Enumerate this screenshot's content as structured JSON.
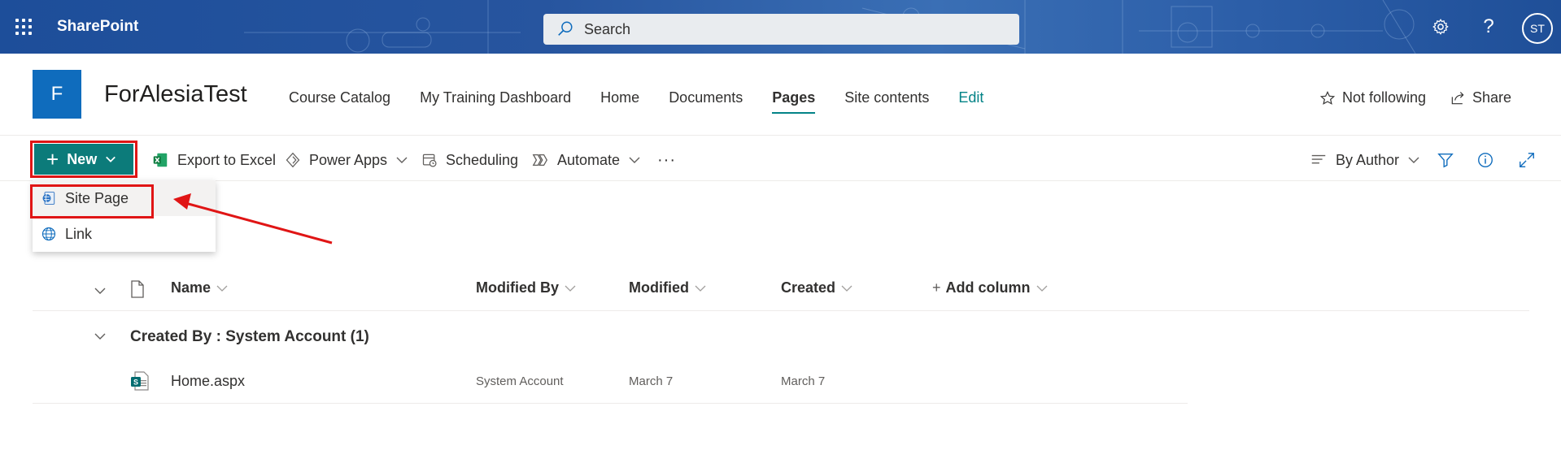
{
  "suite_bar": {
    "app_name": "SharePoint",
    "search_placeholder": "Search",
    "avatar_initials": "ST",
    "icons": [
      "app-launcher-icon",
      "search-icon",
      "settings-icon",
      "help-icon"
    ]
  },
  "site": {
    "logo_letter": "F",
    "title": "ForAlesiaTest",
    "nav": [
      {
        "label": "Course Catalog"
      },
      {
        "label": "My Training Dashboard"
      },
      {
        "label": "Home"
      },
      {
        "label": "Documents"
      },
      {
        "label": "Pages",
        "active": true
      },
      {
        "label": "Site contents"
      },
      {
        "label": "Edit"
      }
    ],
    "follow_label": "Not following",
    "share_label": "Share"
  },
  "command_bar": {
    "new_label": "New",
    "export_label": "Export to Excel",
    "power_apps_label": "Power Apps",
    "scheduling_label": "Scheduling",
    "automate_label": "Automate",
    "more_label": "···",
    "view_label": "By Author"
  },
  "new_menu": {
    "items": [
      {
        "label": "Site Page",
        "icon": "site-page-icon"
      },
      {
        "label": "Link",
        "icon": "globe-icon"
      }
    ]
  },
  "list": {
    "columns": {
      "name": "Name",
      "modified_by": "Modified By",
      "modified": "Modified",
      "created": "Created",
      "add_column": "Add column"
    },
    "group_header": "Created By : System Account (1)",
    "rows": [
      {
        "name": "Home.aspx",
        "modified_by": "System Account",
        "modified": "March 7",
        "created": "March 7"
      }
    ]
  },
  "colors": {
    "accent": "#0c7b7a",
    "suite_bar": "#27559f",
    "annotation": "#e01515"
  }
}
